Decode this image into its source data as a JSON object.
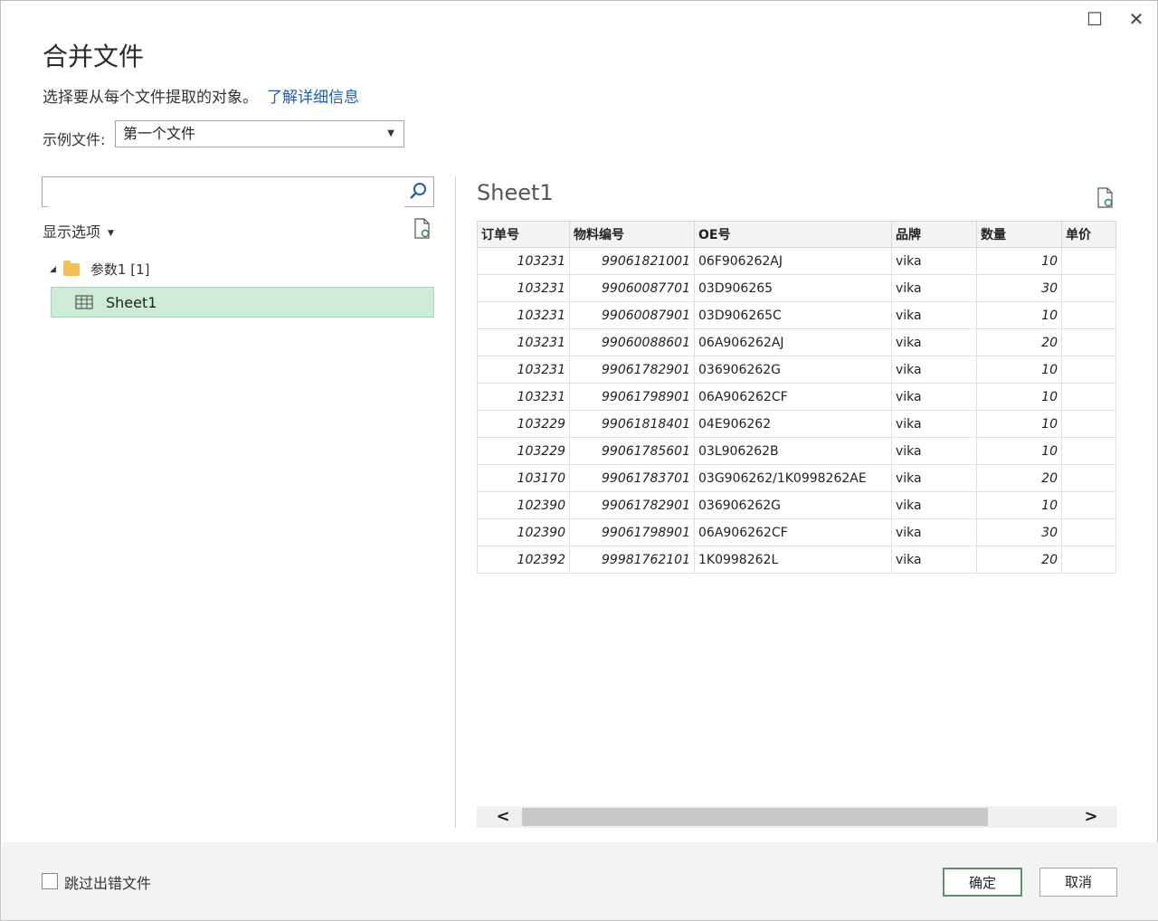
{
  "window": {
    "maximize_icon": "maximize-icon",
    "close_icon": "close-icon"
  },
  "dialog": {
    "title": "合并文件",
    "description": "选择要从每个文件提取的对象。",
    "learn_more_link": "了解详细信息",
    "sample_file_label": "示例文件:",
    "sample_file_value": "第一个文件",
    "search_placeholder": "",
    "display_options": "显示选项"
  },
  "tree": {
    "folder_label": "参数1 [1]",
    "sheet_label": "Sheet1"
  },
  "preview": {
    "title": "Sheet1",
    "columns": [
      "订单号",
      "物料编号",
      "OE号",
      "品牌",
      "数量",
      "单价"
    ],
    "rows": [
      [
        "103231",
        "99061821001",
        "06F906262AJ",
        "vika",
        "10",
        ""
      ],
      [
        "103231",
        "99060087701",
        "03D906265",
        "vika",
        "30",
        ""
      ],
      [
        "103231",
        "99060087901",
        "03D906265C",
        "vika",
        "10",
        ""
      ],
      [
        "103231",
        "99060088601",
        "06A906262AJ",
        "vika",
        "20",
        ""
      ],
      [
        "103231",
        "99061782901",
        "036906262G",
        "vika",
        "10",
        ""
      ],
      [
        "103231",
        "99061798901",
        "06A906262CF",
        "vika",
        "10",
        ""
      ],
      [
        "103229",
        "99061818401",
        "04E906262",
        "vika",
        "10",
        ""
      ],
      [
        "103229",
        "99061785601",
        "03L906262B",
        "vika",
        "10",
        ""
      ],
      [
        "103170",
        "99061783701",
        "03G906262/1K0998262AE",
        "vika",
        "20",
        ""
      ],
      [
        "102390",
        "99061782901",
        "036906262G",
        "vika",
        "10",
        ""
      ],
      [
        "102390",
        "99061798901",
        "06A906262CF",
        "vika",
        "30",
        ""
      ],
      [
        "102392",
        "99981762101",
        "1K0998262L",
        "vika",
        "20",
        ""
      ]
    ]
  },
  "footer": {
    "skip_errors_label": "跳过出错文件",
    "ok_label": "确定",
    "cancel_label": "取消"
  }
}
